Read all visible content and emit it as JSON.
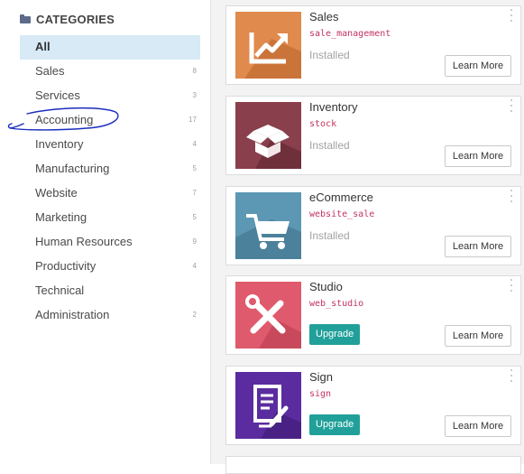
{
  "sidebar": {
    "header": "CATEGORIES",
    "items": [
      {
        "label": "All",
        "count": ""
      },
      {
        "label": "Sales",
        "count": "8"
      },
      {
        "label": "Services",
        "count": "3"
      },
      {
        "label": "Accounting",
        "count": "17"
      },
      {
        "label": "Inventory",
        "count": "4"
      },
      {
        "label": "Manufacturing",
        "count": "5"
      },
      {
        "label": "Website",
        "count": "7"
      },
      {
        "label": "Marketing",
        "count": "5"
      },
      {
        "label": "Human Resources",
        "count": "9"
      },
      {
        "label": "Productivity",
        "count": "4"
      },
      {
        "label": "Technical",
        "count": ""
      },
      {
        "label": "Administration",
        "count": "2"
      }
    ]
  },
  "apps": [
    {
      "title": "Sales",
      "tech": "sale_management",
      "status": "Installed",
      "action": "",
      "learn": "Learn More",
      "icon": "sales-chart-icon",
      "color": "#e08a4d"
    },
    {
      "title": "Inventory",
      "tech": "stock",
      "status": "Installed",
      "action": "",
      "learn": "Learn More",
      "icon": "inventory-box-icon",
      "color": "#8a3f4c"
    },
    {
      "title": "eCommerce",
      "tech": "website_sale",
      "status": "Installed",
      "action": "",
      "learn": "Learn More",
      "icon": "shopping-cart-icon",
      "color": "#5c97b3"
    },
    {
      "title": "Studio",
      "tech": "web_studio",
      "status": "",
      "action": "Upgrade",
      "learn": "Learn More",
      "icon": "tools-icon",
      "color": "#e05a6d"
    },
    {
      "title": "Sign",
      "tech": "sign",
      "status": "",
      "action": "Upgrade",
      "learn": "Learn More",
      "icon": "sign-document-icon",
      "color": "#5b2ca0"
    }
  ],
  "colors": {
    "accent": "#21a09a",
    "tech_name": "#c2335f",
    "active_category": "#d7eaf5",
    "annotation": "#1a2dbd"
  }
}
